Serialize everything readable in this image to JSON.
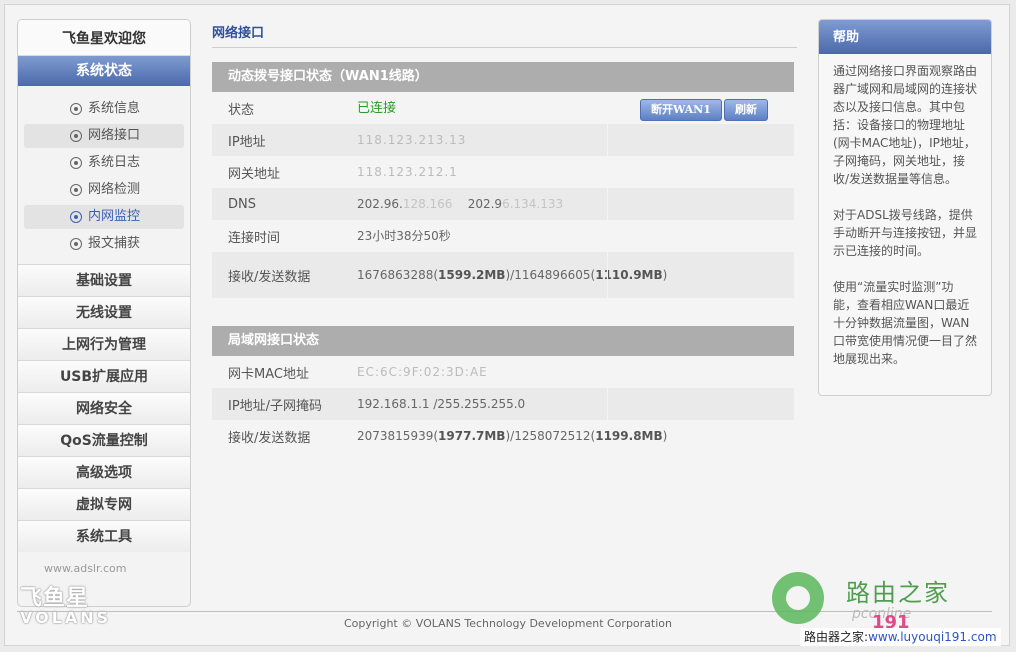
{
  "sidebar": {
    "welcome": "飞鱼星欢迎您",
    "active_section": "系统状态",
    "sub_items": [
      {
        "label": "系统信息"
      },
      {
        "label": "网络接口"
      },
      {
        "label": "系统日志"
      },
      {
        "label": "网络检测"
      },
      {
        "label": "内网监控"
      },
      {
        "label": "报文捕获"
      }
    ],
    "categories": [
      {
        "label": "基础设置"
      },
      {
        "label": "无线设置"
      },
      {
        "label": "上网行为管理"
      },
      {
        "label": "USB扩展应用"
      },
      {
        "label": "网络安全"
      },
      {
        "label": "QoS流量控制"
      },
      {
        "label": "高级选项"
      },
      {
        "label": "虚拟专网"
      },
      {
        "label": "系统工具"
      }
    ],
    "logo_url": "www.adslr.com",
    "logo_cn": "飞鱼星",
    "logo_en": "VOLANS"
  },
  "main": {
    "page_title": "网络接口",
    "wan": {
      "heading": "动态拨号接口状态（WAN1线路）",
      "status_label": "状态",
      "status_value": "已连接",
      "disconnect_button": "断开WAN1",
      "refresh_button": "刷新",
      "ip_label": "IP地址",
      "ip_value": "118.123.213.13",
      "gateway_label": "网关地址",
      "gateway_value": "118.123.212.1",
      "dns_label": "DNS",
      "dns_1a": "202.96.",
      "dns_1b": "128.166",
      "dns_2a": "202.9",
      "dns_2b": "6.134.133",
      "uptime_label": "连接时间",
      "uptime_value": "23小时38分50秒",
      "traffic_label": "接收/发送数据",
      "rx_bytes": "1676863288",
      "rx_mb": "1599.2MB",
      "tx_bytes": "1164896605",
      "tx_mb": "1110.9MB"
    },
    "lan": {
      "heading": "局域网接口状态",
      "mac_label": "网卡MAC地址",
      "mac_value": "EC:6C:9F:02:3D:AE",
      "ip_label": "IP地址/子网掩码",
      "ip_value": "192.168.1.1 /255.255.255.0",
      "traffic_label": "接收/发送数据",
      "rx_bytes": "2073815939",
      "rx_mb": "1977.7MB",
      "tx_bytes": "1258072512",
      "tx_mb": "1199.8MB"
    }
  },
  "help": {
    "title": "帮助",
    "para1": "通过网络接口界面观察路由器广域网和局域网的连接状态以及接口信息。其中包括：设备接口的物理地址(网卡MAC地址)，IP地址，子网掩码，网关地址，接收/发送数据量等信息。",
    "para2": "对于ADSL拨号线路，提供手动断开与连接按钮，并显示已连接的时间。",
    "para3": "使用“流量实时监测”功能，查看相应WAN口最近十分钟数据流量图，WAN口带宽使用情况便一目了然地展现出来。"
  },
  "footer": {
    "copyright": "Copyright © VOLANS Technology Development Corporation"
  },
  "watermark": {
    "title": "路由之家",
    "sub": "pconline",
    "num": "191",
    "url_prefix": "路由器之家",
    "url": "www.luyouqi191.com"
  }
}
